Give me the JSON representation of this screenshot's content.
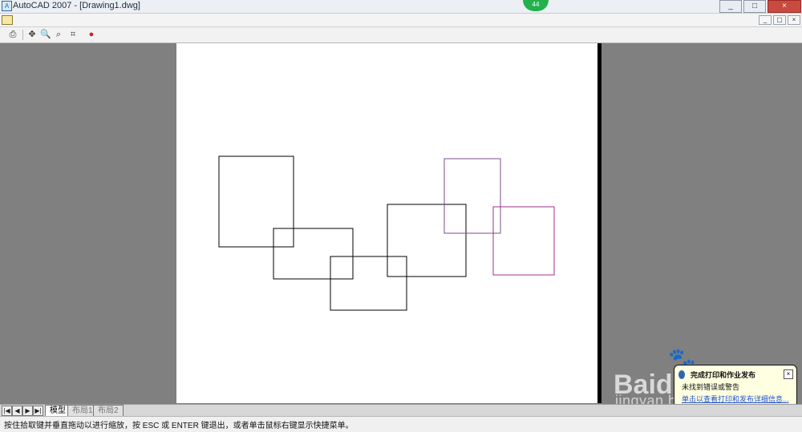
{
  "app": {
    "title": "AutoCAD 2007 - [Drawing1.dwg]",
    "counter_badge": "44",
    "window_controls": [
      "_",
      "□",
      "×"
    ]
  },
  "menubar": {
    "document_controls": [
      "_",
      "▢",
      "×"
    ]
  },
  "toolbar": {
    "buttons": [
      {
        "name": "print-icon",
        "glyph": "⎙"
      },
      {
        "name": "pan-icon",
        "glyph": "✥"
      },
      {
        "name": "zoom-realtime-icon",
        "glyph": "🔍"
      },
      {
        "name": "zoom-window-icon",
        "glyph": "⌕"
      },
      {
        "name": "zoom-original-icon",
        "glyph": "⌗"
      },
      {
        "name": "close-preview-icon",
        "glyph": "●"
      }
    ]
  },
  "tabs": {
    "nav": [
      "|◀",
      "◀",
      "▶",
      "▶|"
    ],
    "items": [
      "模型",
      "布局1",
      "布局2"
    ],
    "active": "模型"
  },
  "status": {
    "text": "按住拾取键并垂直拖动以进行缩放，按 ESC 或 ENTER 键退出，或者单击鼠标右键显示快捷菜单。"
  },
  "notification": {
    "title": "完成打印和作业发布",
    "desc": "未找到错误或警告",
    "link": "单击以查看打印和发布详细信息...",
    "close_label": "×"
  },
  "watermark": {
    "main": "Baidu经验",
    "sub": "jingyan.baidu.com"
  },
  "colors": {
    "paper": "#ffffff",
    "background": "#808080",
    "rect_black": "#000000",
    "rect_purple": "#7b4e8e",
    "rect_magenta": "#a12f8f"
  }
}
